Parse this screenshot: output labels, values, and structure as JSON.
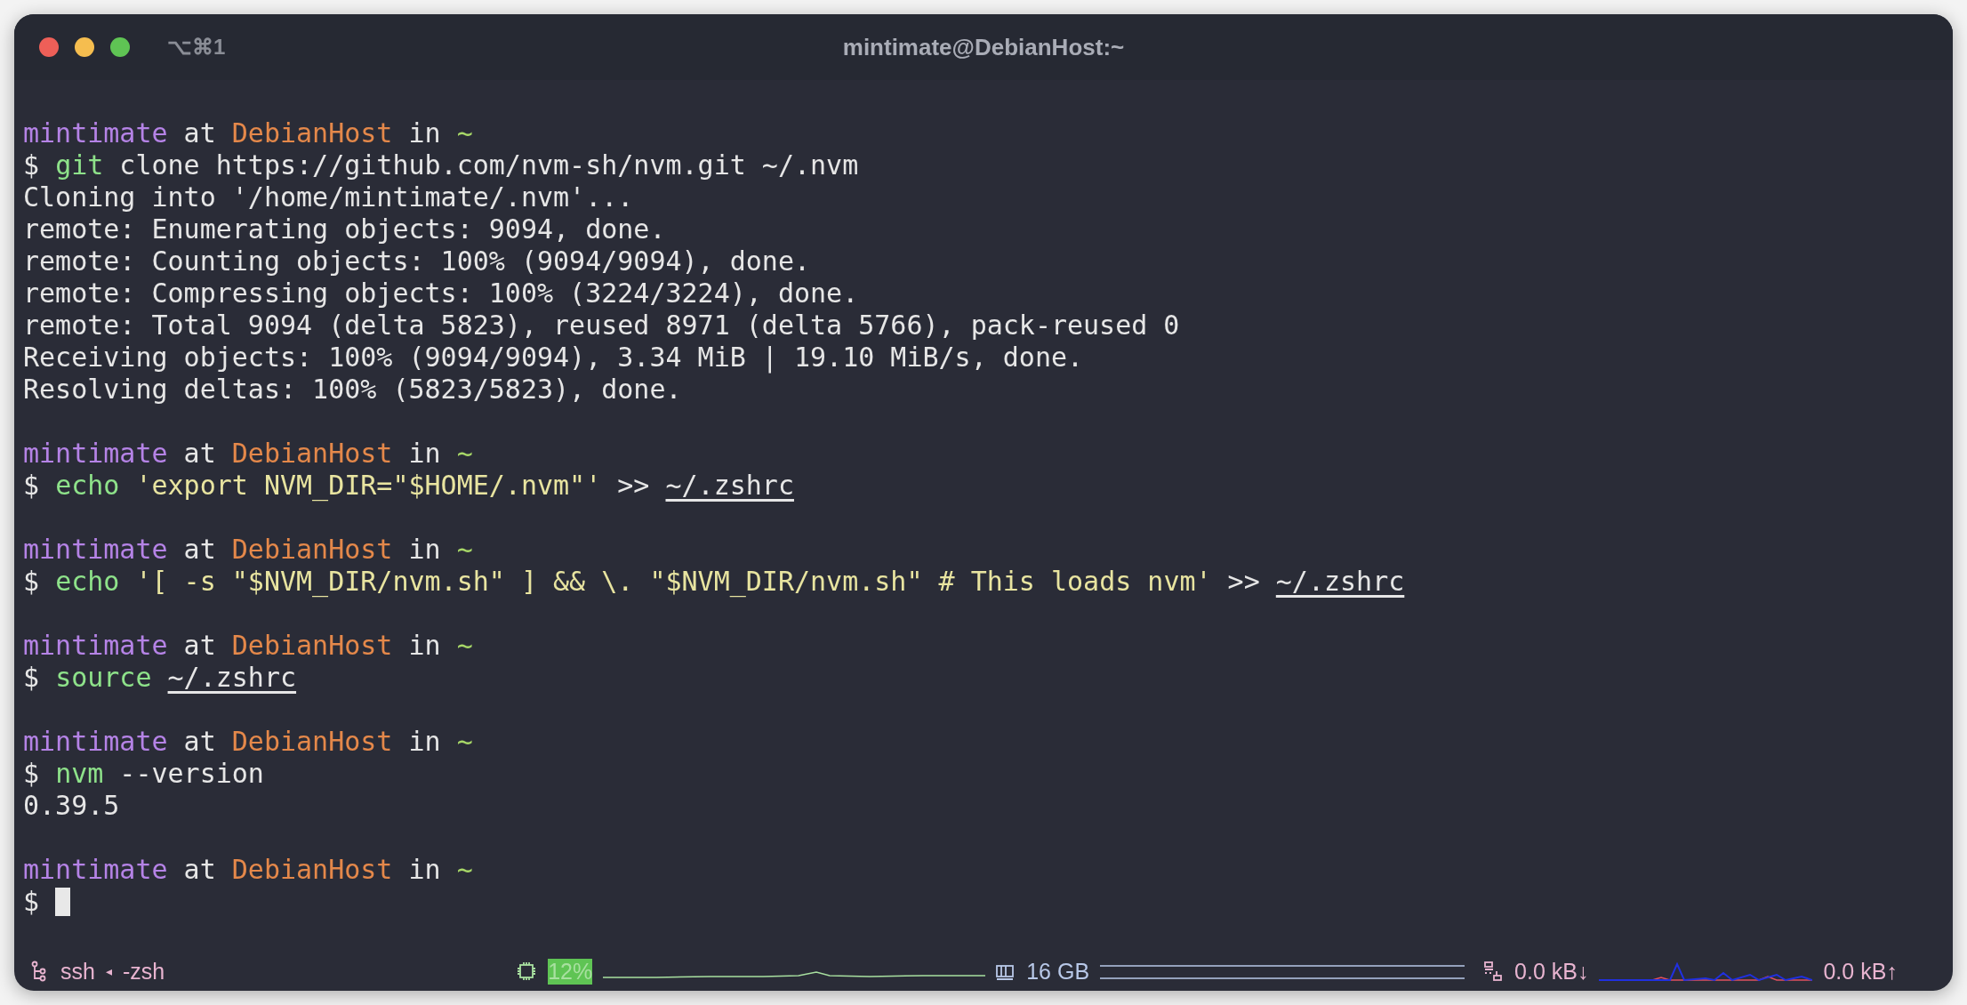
{
  "window": {
    "title": "mintimate@DebianHost:~",
    "shortcut": "⌥⌘1"
  },
  "terminal": {
    "lines": [
      {
        "kind": "text",
        "segments": [
          {
            "kind": "user",
            "text": "mintimate"
          },
          {
            "kind": "plain",
            "text": " at "
          },
          {
            "kind": "host",
            "text": "DebianHost"
          },
          {
            "kind": "plain",
            "text": " in "
          },
          {
            "kind": "dir",
            "text": "~"
          }
        ]
      },
      {
        "kind": "text",
        "segments": [
          {
            "kind": "plain",
            "text": "$ "
          },
          {
            "kind": "cmd",
            "text": "git"
          },
          {
            "kind": "plain",
            "text": " clone https://github.com/nvm-sh/nvm.git ~/.nvm"
          }
        ]
      },
      {
        "kind": "text",
        "segments": [
          {
            "kind": "plain",
            "text": "Cloning into '/home/mintimate/.nvm'..."
          }
        ]
      },
      {
        "kind": "text",
        "segments": [
          {
            "kind": "plain",
            "text": "remote: Enumerating objects: 9094, done."
          }
        ]
      },
      {
        "kind": "text",
        "segments": [
          {
            "kind": "plain",
            "text": "remote: Counting objects: 100% (9094/9094), done."
          }
        ]
      },
      {
        "kind": "text",
        "segments": [
          {
            "kind": "plain",
            "text": "remote: Compressing objects: 100% (3224/3224), done."
          }
        ]
      },
      {
        "kind": "text",
        "segments": [
          {
            "kind": "plain",
            "text": "remote: Total 9094 (delta 5823), reused 8971 (delta 5766), pack-reused 0"
          }
        ]
      },
      {
        "kind": "text",
        "segments": [
          {
            "kind": "plain",
            "text": "Receiving objects: 100% (9094/9094), 3.34 MiB | 19.10 MiB/s, done."
          }
        ]
      },
      {
        "kind": "text",
        "segments": [
          {
            "kind": "plain",
            "text": "Resolving deltas: 100% (5823/5823), done."
          }
        ]
      },
      {
        "kind": "blank"
      },
      {
        "kind": "text",
        "segments": [
          {
            "kind": "user",
            "text": "mintimate"
          },
          {
            "kind": "plain",
            "text": " at "
          },
          {
            "kind": "host",
            "text": "DebianHost"
          },
          {
            "kind": "plain",
            "text": " in "
          },
          {
            "kind": "dir",
            "text": "~"
          }
        ]
      },
      {
        "kind": "text",
        "segments": [
          {
            "kind": "plain",
            "text": "$ "
          },
          {
            "kind": "cmd",
            "text": "echo "
          },
          {
            "kind": "string",
            "text": "'export NVM_DIR=\"$HOME/.nvm\"'"
          },
          {
            "kind": "plain",
            "text": " >> "
          },
          {
            "kind": "path",
            "text": "~/.zshrc"
          }
        ]
      },
      {
        "kind": "blank"
      },
      {
        "kind": "text",
        "segments": [
          {
            "kind": "user",
            "text": "mintimate"
          },
          {
            "kind": "plain",
            "text": " at "
          },
          {
            "kind": "host",
            "text": "DebianHost"
          },
          {
            "kind": "plain",
            "text": " in "
          },
          {
            "kind": "dir",
            "text": "~"
          }
        ]
      },
      {
        "kind": "text",
        "segments": [
          {
            "kind": "plain",
            "text": "$ "
          },
          {
            "kind": "cmd",
            "text": "echo "
          },
          {
            "kind": "string",
            "text": "'[ -s \"$NVM_DIR/nvm.sh\" ] && \\. \"$NVM_DIR/nvm.sh\" # This loads nvm'"
          },
          {
            "kind": "plain",
            "text": " >> "
          },
          {
            "kind": "path",
            "text": "~/.zshrc"
          }
        ]
      },
      {
        "kind": "blank"
      },
      {
        "kind": "text",
        "segments": [
          {
            "kind": "user",
            "text": "mintimate"
          },
          {
            "kind": "plain",
            "text": " at "
          },
          {
            "kind": "host",
            "text": "DebianHost"
          },
          {
            "kind": "plain",
            "text": " in "
          },
          {
            "kind": "dir",
            "text": "~"
          }
        ]
      },
      {
        "kind": "text",
        "segments": [
          {
            "kind": "plain",
            "text": "$ "
          },
          {
            "kind": "cmd",
            "text": "source "
          },
          {
            "kind": "path",
            "text": "~/.zshrc"
          }
        ]
      },
      {
        "kind": "blank"
      },
      {
        "kind": "text",
        "segments": [
          {
            "kind": "user",
            "text": "mintimate"
          },
          {
            "kind": "plain",
            "text": " at "
          },
          {
            "kind": "host",
            "text": "DebianHost"
          },
          {
            "kind": "plain",
            "text": " in "
          },
          {
            "kind": "dir",
            "text": "~"
          }
        ]
      },
      {
        "kind": "text",
        "segments": [
          {
            "kind": "plain",
            "text": "$ "
          },
          {
            "kind": "cmd",
            "text": "nvm"
          },
          {
            "kind": "plain",
            "text": " --version"
          }
        ]
      },
      {
        "kind": "text",
        "segments": [
          {
            "kind": "plain",
            "text": "0.39.5"
          }
        ]
      },
      {
        "kind": "blank"
      },
      {
        "kind": "text",
        "segments": [
          {
            "kind": "user",
            "text": "mintimate"
          },
          {
            "kind": "plain",
            "text": " at "
          },
          {
            "kind": "host",
            "text": "DebianHost"
          },
          {
            "kind": "plain",
            "text": " in "
          },
          {
            "kind": "dir",
            "text": "~"
          }
        ]
      },
      {
        "kind": "text",
        "cursor": true,
        "segments": [
          {
            "kind": "plain",
            "text": "$ "
          }
        ]
      }
    ]
  },
  "status_bar": {
    "session": {
      "host": "ssh",
      "separator": "◂",
      "shell": "-zsh"
    },
    "cpu": {
      "reading": "12%"
    },
    "memory": {
      "reading": "16 GB"
    },
    "network": {
      "down": "0.0 kB↓",
      "up": "0.0 kB↑"
    }
  }
}
